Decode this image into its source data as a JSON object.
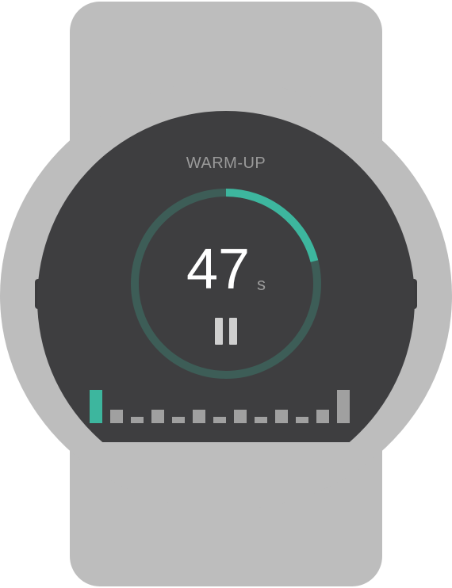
{
  "workout": {
    "phase_label": "WARM-UP",
    "timer_value": "47",
    "timer_unit": "s",
    "progress_fraction": 0.21,
    "current_interval_index": 0
  },
  "icons": {
    "pause": "pause-icon"
  },
  "colors": {
    "accent": "#3db69e",
    "ring_track": "#3d5d57",
    "face": "#3e3e40",
    "watch_body": "#bdbdbd",
    "interval_bar": "#a0a0a0"
  },
  "intervals": [
    {
      "level": 1.0
    },
    {
      "level": 0.4
    },
    {
      "level": 0.2
    },
    {
      "level": 0.4
    },
    {
      "level": 0.2
    },
    {
      "level": 0.4
    },
    {
      "level": 0.2
    },
    {
      "level": 0.4
    },
    {
      "level": 0.2
    },
    {
      "level": 0.4
    },
    {
      "level": 0.2
    },
    {
      "level": 0.4
    },
    {
      "level": 1.0
    }
  ]
}
